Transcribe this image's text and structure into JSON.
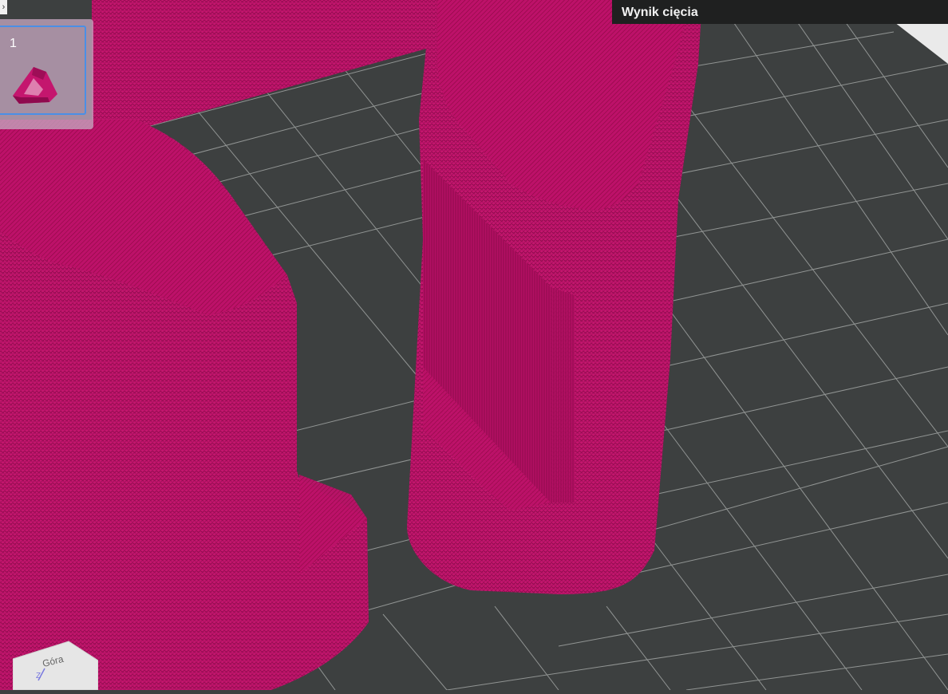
{
  "header": {
    "title": "Wynik cięcia"
  },
  "plate": {
    "number": "1"
  },
  "nav_cube": {
    "face": "Góra",
    "axis": "Z"
  },
  "colors": {
    "model": "#c4166e",
    "model_dark": "#8f0a4e",
    "grid": "#a6aaa8",
    "bed": "#3d4040",
    "selection": "#4a8fe6"
  }
}
